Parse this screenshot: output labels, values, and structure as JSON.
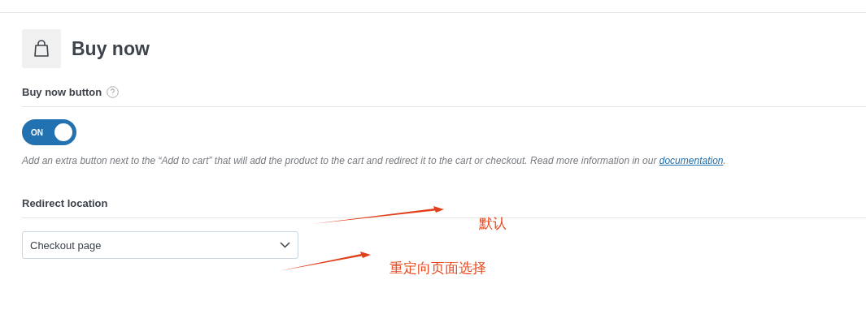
{
  "section": {
    "title": "Buy now"
  },
  "buy_now_button": {
    "label": "Buy now button",
    "toggle": {
      "on": true,
      "label": "ON"
    },
    "description": {
      "text": "Add an extra button next to the “Add to cart” that will add the product to the cart and redirect it to the cart or checkout. Read more information in our ",
      "link": "documentation",
      "after": "."
    }
  },
  "redirect_location": {
    "label": "Redirect location",
    "value": "Checkout page"
  },
  "annotations": [
    {
      "text": "默认"
    },
    {
      "text": "重定向页面选择"
    }
  ]
}
